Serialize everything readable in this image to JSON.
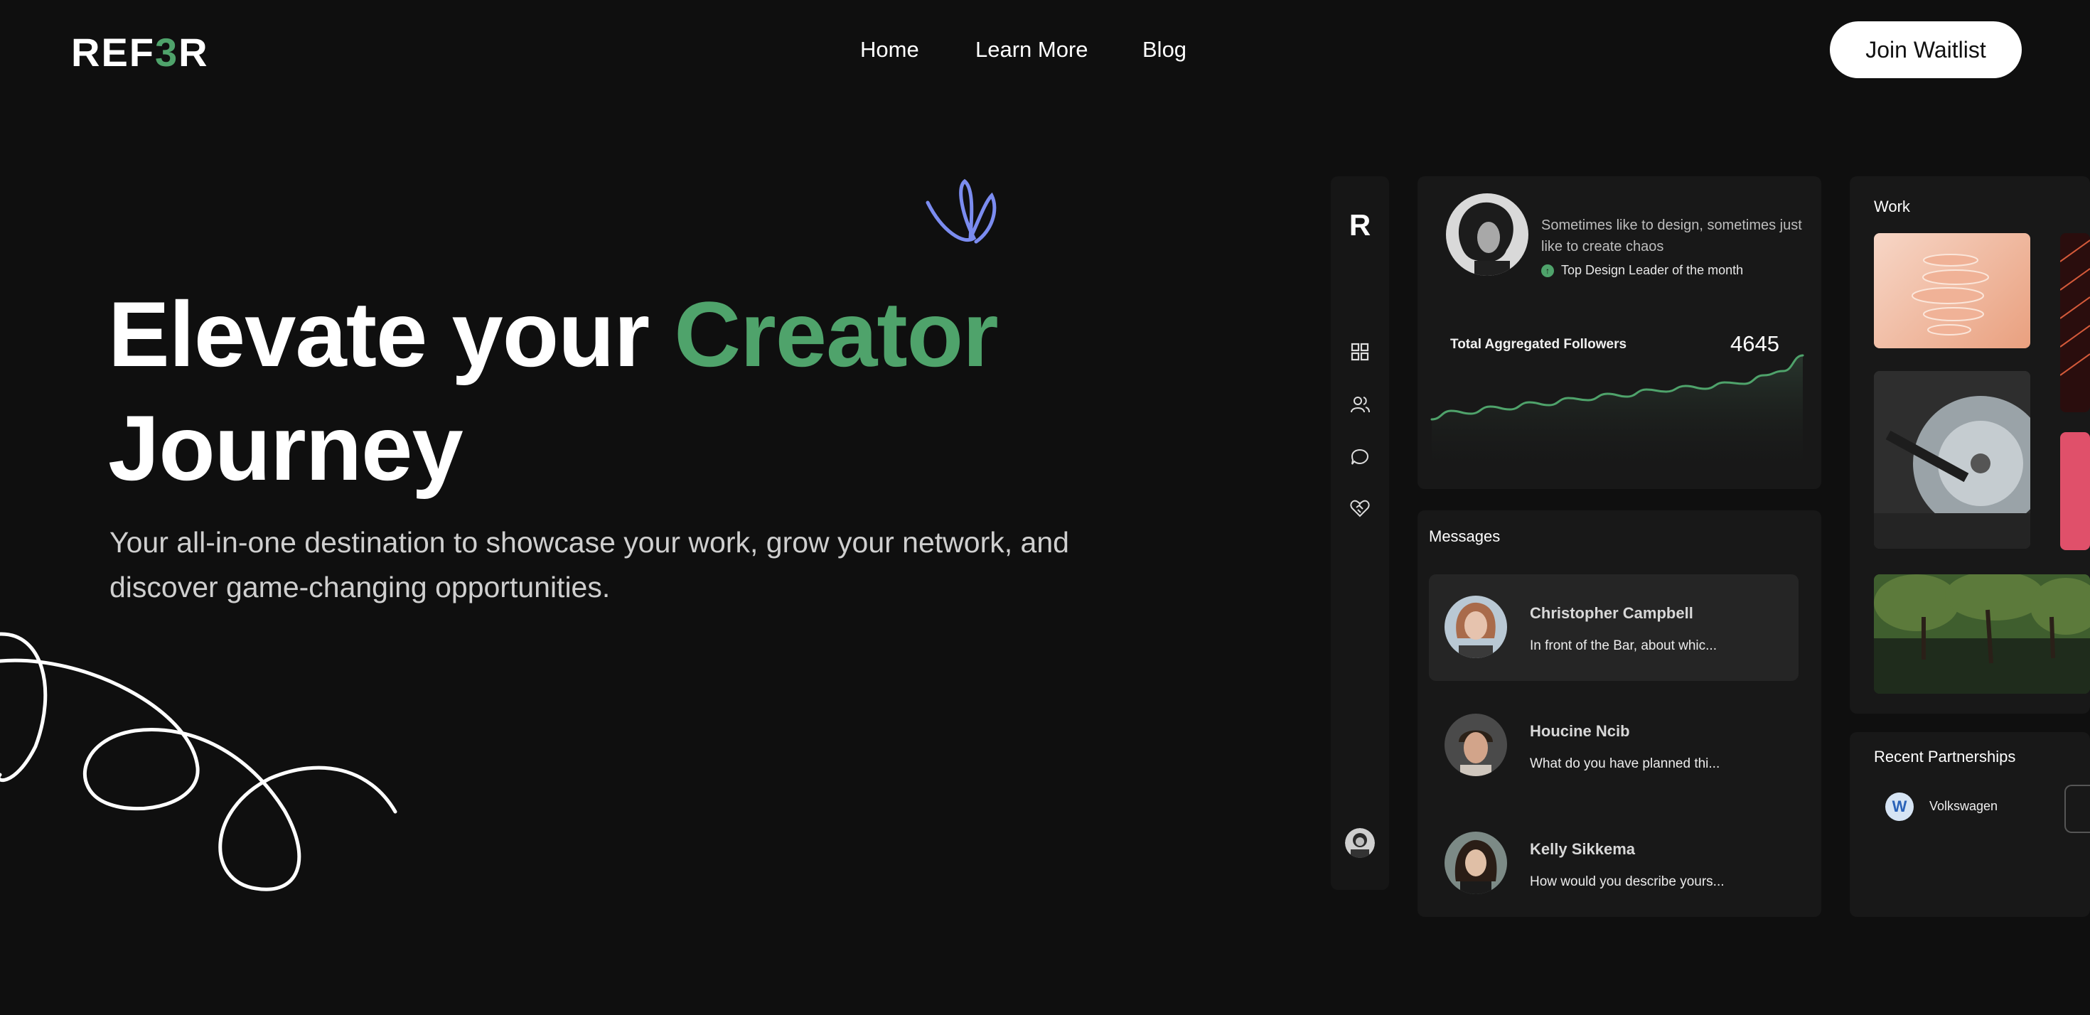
{
  "brand": {
    "logo_a": "REF",
    "logo_b": "3",
    "logo_c": "R",
    "accent_color": "#4fa36b"
  },
  "nav": {
    "links": [
      "Home",
      "Learn More",
      "Blog"
    ],
    "cta": "Join Waitlist"
  },
  "hero": {
    "title_a": "Elevate your ",
    "title_accent": "Creator",
    "title_b": "Journey",
    "subtitle_line1": "Your all-in-one destination to showcase your work, grow your network, and",
    "subtitle_line2": "discover game-changing opportunities."
  },
  "dashboard": {
    "sidebar": {
      "logo": "R",
      "icons": [
        "grid-icon",
        "users-icon",
        "chat-icon",
        "heart-handshake-icon"
      ]
    },
    "profile": {
      "bio": "Sometimes like to design, sometimes just like to create chaos",
      "badge": "Top Design Leader of the month",
      "followers_label": "Total Aggregated Followers",
      "followers_count": "4645"
    },
    "messages": {
      "title": "Messages",
      "items": [
        {
          "name": "Christopher Campbell",
          "preview": "In front of the Bar, about whic..."
        },
        {
          "name": "Houcine Ncib",
          "preview": "What do you have planned thi..."
        },
        {
          "name": "Kelly Sikkema",
          "preview": "How would you describe yours..."
        }
      ]
    },
    "work": {
      "title": "Work"
    },
    "partnerships": {
      "title": "Recent Partnerships",
      "items": [
        "Volkswagen"
      ]
    }
  },
  "chart_data": {
    "type": "line",
    "title": "Total Aggregated Followers",
    "values": [
      10,
      22,
      18,
      28,
      24,
      34,
      30,
      40,
      37,
      46,
      42,
      52,
      49,
      57,
      53,
      62,
      60,
      72,
      78,
      100
    ]
  }
}
